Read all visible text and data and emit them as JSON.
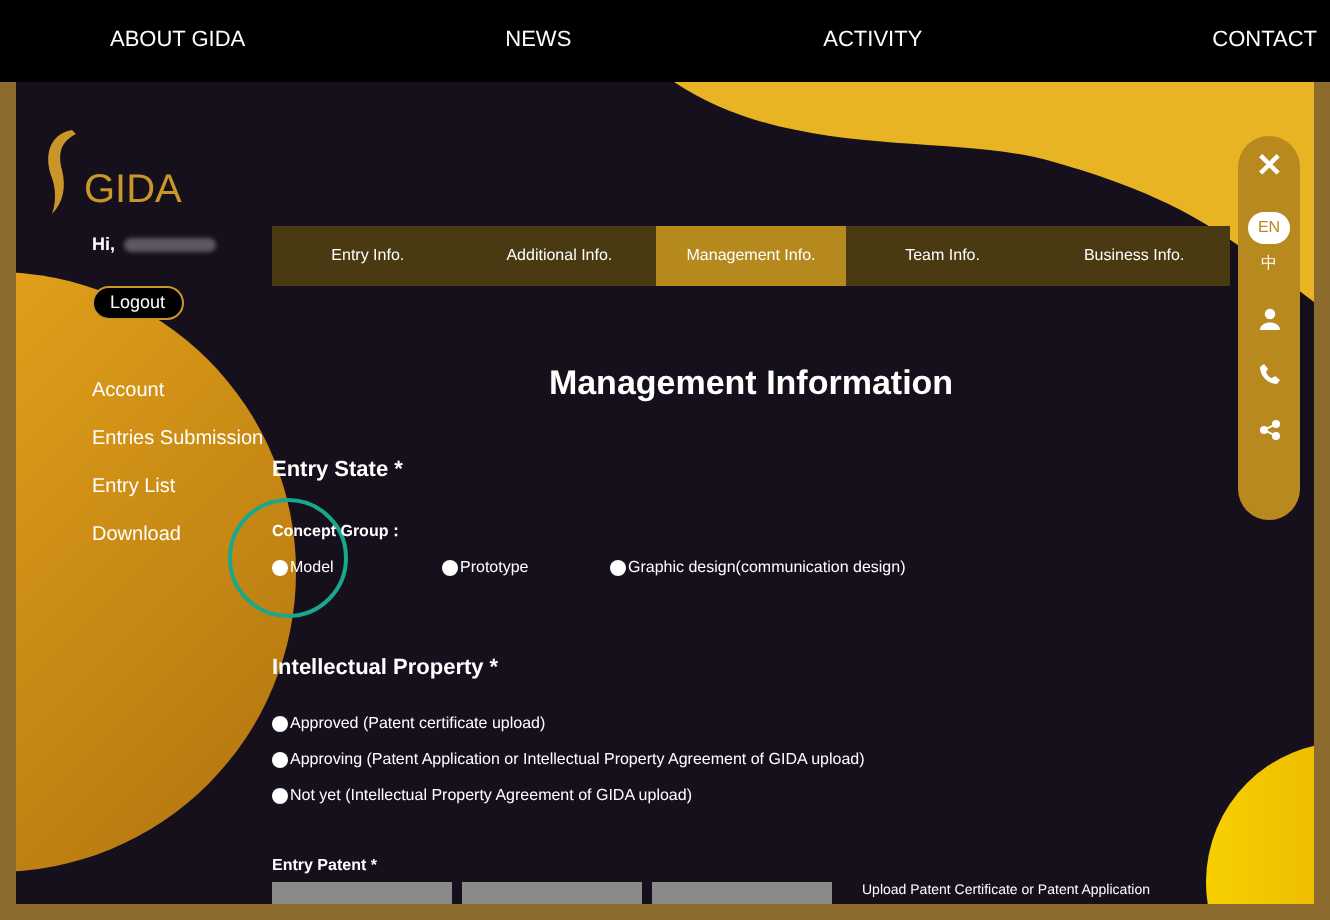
{
  "nav": [
    {
      "label": "ABOUT GIDA"
    },
    {
      "label": "NEWS"
    },
    {
      "label": "ACTIVITY"
    },
    {
      "label": "CONTACT"
    }
  ],
  "logo": {
    "text": "GIDA"
  },
  "user": {
    "greeting": "Hi,",
    "logout": "Logout"
  },
  "sidebar": {
    "items": [
      {
        "label": "Account"
      },
      {
        "label": "Entries Submission"
      },
      {
        "label": "Entry List"
      },
      {
        "label": "Download"
      }
    ]
  },
  "tabs": [
    {
      "label": "Entry Info.",
      "selected": false
    },
    {
      "label": "Additional Info.",
      "selected": false
    },
    {
      "label": "Management Info.",
      "selected": true
    },
    {
      "label": "Team Info.",
      "selected": false
    },
    {
      "label": "Business Info.",
      "selected": false
    }
  ],
  "title": "Management Information",
  "entry_state": {
    "heading": "Entry State *",
    "group_label": "Concept Group：",
    "options": [
      {
        "label": "Model",
        "selected": false
      },
      {
        "label": "Prototype",
        "selected": false
      },
      {
        "label": "Graphic design(communication design)",
        "selected": false
      }
    ]
  },
  "intellectual_property": {
    "heading": "Intellectual Property *",
    "options": [
      {
        "label": "Approved (Patent certificate upload)",
        "selected": false
      },
      {
        "label": "Approving (Patent Application or Intellectual Property Agreement of GIDA upload)",
        "selected": false
      },
      {
        "label": "Not yet (Intellectual Property Agreement of GIDA upload)",
        "selected": false
      }
    ]
  },
  "entry_patent": {
    "heading": "Entry Patent *",
    "upload_hint": "Upload Patent Certificate or Patent Application"
  },
  "float_panel": {
    "close": "✕",
    "languages": [
      {
        "label": "EN",
        "selected": true
      },
      {
        "label": "中",
        "selected": false
      }
    ]
  }
}
